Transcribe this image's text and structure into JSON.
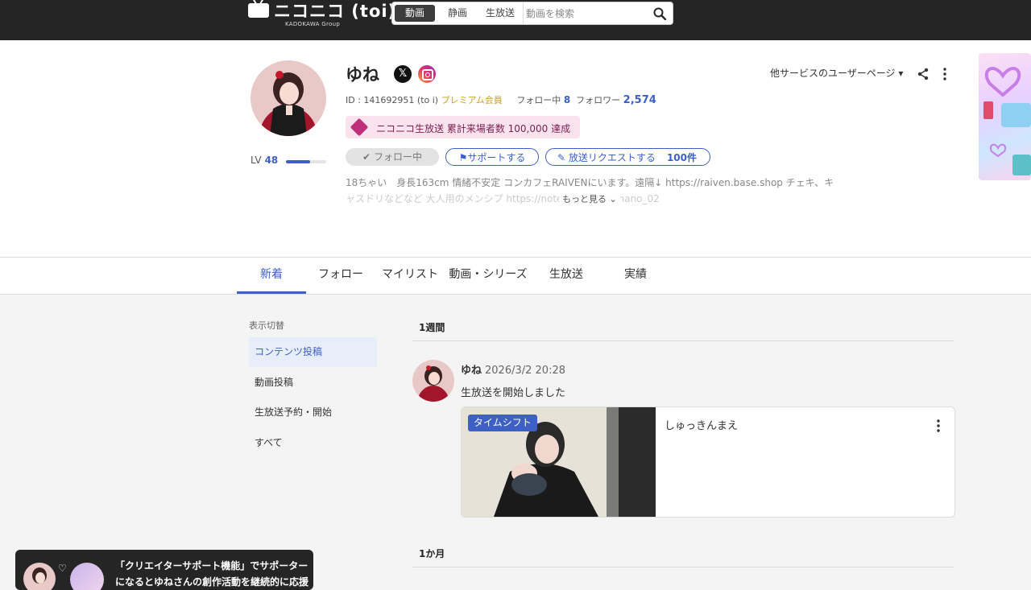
{
  "header": {
    "brand": "ニコニコ (toi)",
    "brand_sub": "KADOKAWA Group",
    "search_tabs": [
      {
        "label": "動画",
        "active": true
      },
      {
        "label": "静画",
        "active": false
      },
      {
        "label": "生放送",
        "active": false
      }
    ],
    "search_placeholder": "動画を検索"
  },
  "profile": {
    "name": "ゆね",
    "level_label": "LV",
    "level": "48",
    "level_progress_percent": 60,
    "id_text": "ID : 141692951 (to i)",
    "premium": "プレミアム会員",
    "following_label": "フォロー中",
    "following_count": "8",
    "follower_label": "フォロワー",
    "follower_count": "2,574",
    "achievement": "ニコニコ生放送 累計来場者数 100,000 達成",
    "follow_button": "フォロー中",
    "support_button": "サポートする",
    "request_button": "放送リクエストする",
    "request_count": "100件",
    "bio_line1": "18ちゃい　身長163cm 情緒不安定 コンカフェRAIVENにいます。遠隔↓ https://raiven.base.shop チェキ、キ",
    "bio_line2": "ャスドリなどなど 大人用のメンシプ https://note.com/yune_nano_02",
    "more": "もっと見る",
    "other_services": "他サービスのユーザーページ"
  },
  "tabs": [
    {
      "label": "新着",
      "active": true
    },
    {
      "label": "フォロー",
      "active": false
    },
    {
      "label": "マイリスト",
      "active": false
    },
    {
      "label": "動画・シリーズ",
      "active": false
    },
    {
      "label": "生放送",
      "active": false
    },
    {
      "label": "実績",
      "active": false
    }
  ],
  "sidebar": {
    "heading": "表示切替",
    "items": [
      {
        "label": "コンテンツ投稿",
        "active": true
      },
      {
        "label": "動画投稿",
        "active": false
      },
      {
        "label": "生放送予約・開始",
        "active": false
      },
      {
        "label": "すべて",
        "active": false
      }
    ]
  },
  "feed": {
    "period1": "1週間",
    "period2": "1か月",
    "items": [
      {
        "user": "ゆね",
        "time": "2026/3/2 20:28",
        "message": "生放送を開始しました",
        "badge": "タイムシフト",
        "title": "しゅっきんまえ"
      }
    ]
  },
  "toast": {
    "text": "「クリエイターサポート機能」でサポーターになるとゆねさんの創作活動を継続的に応援でき"
  },
  "colors": {
    "accent": "#3d5fc6",
    "topbar": "#252525",
    "badge_bg": "#fbe3ee"
  }
}
